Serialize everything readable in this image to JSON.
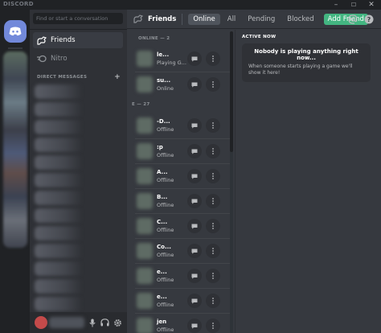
{
  "window": {
    "brand": "DISCORD",
    "controls": [
      "–",
      "☐",
      "✕"
    ]
  },
  "sidebar": {
    "search_placeholder": "Find or start a conversation",
    "nav": [
      {
        "label": "Friends"
      },
      {
        "label": "Nitro"
      }
    ],
    "dm_header": "DIRECT MESSAGES",
    "dm_add": "+"
  },
  "toolbar": {
    "title": "Friends",
    "tabs": [
      "Online",
      "All",
      "Pending",
      "Blocked"
    ],
    "add_friend": "Add Friend"
  },
  "friends": {
    "online_header": "ONLINE — 2",
    "offline_header": "E — 27",
    "items": [
      {
        "name": "le...",
        "status": "Playing G..."
      },
      {
        "name": "su...",
        "status": "Online"
      },
      {
        "name": "-D...",
        "status": "Offline"
      },
      {
        "name": ":p",
        "status": "Offline"
      },
      {
        "name": "A...",
        "status": "Offline"
      },
      {
        "name": "B...",
        "status": "Offline"
      },
      {
        "name": "C...",
        "status": "Offline"
      },
      {
        "name": "Co...",
        "status": "Offline"
      },
      {
        "name": "e...",
        "status": "Offline"
      },
      {
        "name": "e...",
        "status": "Offline"
      },
      {
        "name": "jen",
        "status": "Offline"
      }
    ]
  },
  "active_now": {
    "title": "ACTIVE NOW",
    "heading": "Nobody is playing anything right now...",
    "body": "When someone starts playing a game we'll show it here!"
  },
  "colors": {
    "blurple": "#7289da",
    "green": "#43b581",
    "bg_main": "#36393f",
    "bg_sidebar": "#2f3136",
    "bg_rail": "#202225"
  },
  "icons": [
    "discord-logo-icon",
    "friends-wave-icon",
    "nitro-icon",
    "chat-bubble-icon",
    "more-vertical-icon",
    "mention-icon",
    "help-icon",
    "mic-icon",
    "headphones-icon",
    "settings-gear-icon"
  ]
}
